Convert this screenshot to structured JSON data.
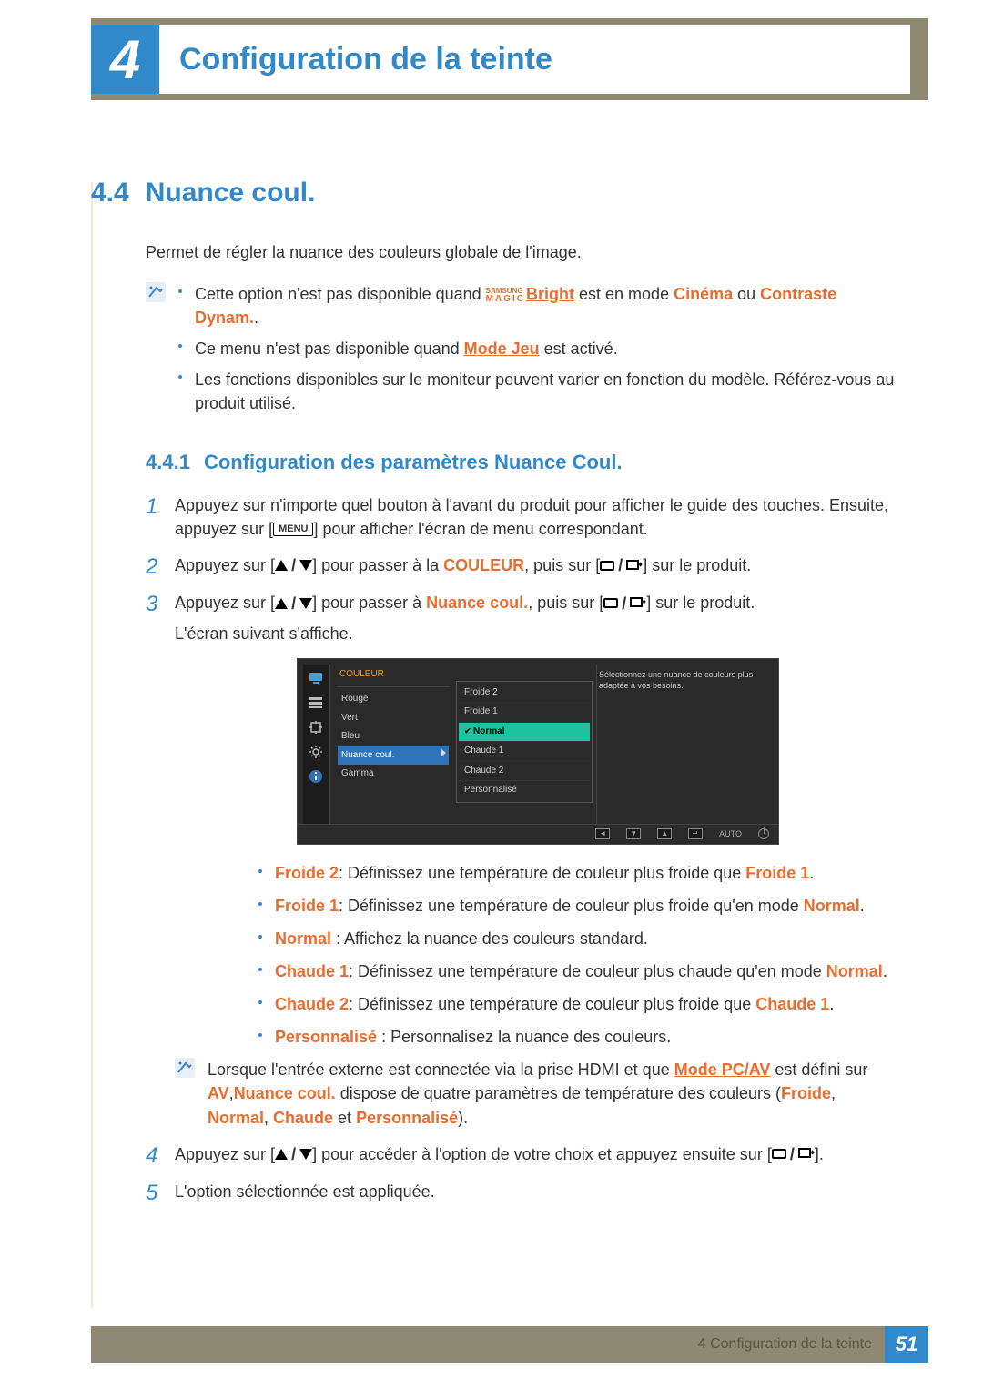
{
  "chapter": {
    "number": "4",
    "title": "Configuration de la teinte"
  },
  "section": {
    "number": "4.4",
    "title": "Nuance coul."
  },
  "intro": "Permet de régler la nuance des couleurs globale de l'image.",
  "notes1": {
    "items": [
      {
        "pre": "Cette option n'est pas disponible quand ",
        "magic_brand": "SAMSUNG",
        "magic_word": "MAGIC",
        "magic_suffix": "Bright",
        "mid": " est en mode ",
        "red1": "Cinéma",
        "mid2": " ou ",
        "red2": "Contraste Dynam.",
        "post": "."
      },
      {
        "text_pre": "Ce menu n'est pas disponible quand ",
        "link": "Mode Jeu",
        "text_post": " est activé."
      },
      {
        "plain": "Les fonctions disponibles sur le moniteur peuvent varier en fonction du modèle. Référez-vous au produit utilisé."
      }
    ]
  },
  "subsection": {
    "number": "4.4.1",
    "title": "Configuration des paramètres Nuance Coul."
  },
  "steps": {
    "s1a": "Appuyez sur n'importe quel bouton à l'avant du produit pour afficher le guide des touches. Ensuite, appuyez sur [",
    "s1_menu": "MENU",
    "s1b": "] pour afficher l'écran de menu correspondant.",
    "s2a": "Appuyez sur [",
    "s2b": "] pour passer à la ",
    "s2_red": "COULEUR",
    "s2c": ", puis sur [",
    "s2d": "] sur le produit.",
    "s3a": "Appuyez sur [",
    "s3b": "] pour passer à ",
    "s3_red": "Nuance coul.",
    "s3c": ", puis sur [",
    "s3d": "] sur le produit.",
    "s3e": "L'écran suivant s'affiche.",
    "s4a": "Appuyez sur [",
    "s4b": "] pour accéder à l'option de votre choix et appuyez ensuite sur [",
    "s4c": "].",
    "s5": "L'option sélectionnée est appliquée."
  },
  "osd": {
    "title": "COULEUR",
    "menu": [
      "Rouge",
      "Vert",
      "Bleu",
      "Nuance coul.",
      "Gamma"
    ],
    "menu_selected_index": 3,
    "submenu": [
      "Froide 2",
      "Froide 1",
      "Normal",
      "Chaude 1",
      "Chaude 2",
      "Personnalisé"
    ],
    "submenu_selected_index": 2,
    "desc": "Sélectionnez une nuance de couleurs plus adaptée à vos besoins.",
    "btn_auto": "AUTO"
  },
  "options": [
    {
      "name": "Froide 2",
      "desc": ": Définissez une température de couleur plus froide que ",
      "ref": "Froide 1",
      "tail": "."
    },
    {
      "name": "Froide 1",
      "desc": ": Définissez une température de couleur plus froide qu'en mode ",
      "ref": "Normal",
      "tail": "."
    },
    {
      "name": "Normal",
      "desc": " : Affichez la nuance des couleurs standard.",
      "ref": "",
      "tail": ""
    },
    {
      "name": "Chaude 1",
      "desc": ": Définissez une température de couleur plus chaude qu'en mode ",
      "ref": "Normal",
      "tail": "."
    },
    {
      "name": "Chaude 2",
      "desc": ": Définissez une température de couleur plus froide que ",
      "ref": "Chaude 1",
      "tail": "."
    },
    {
      "name": "Personnalisé",
      "desc": " : Personnalisez la nuance des couleurs.",
      "ref": "",
      "tail": ""
    }
  ],
  "note2": {
    "pre": "Lorsque l'entrée externe est connectée via la prise HDMI et que ",
    "link": "Mode PC/AV",
    "mid1": " est défini sur ",
    "av": "AV",
    "mid2": ",",
    "nuance": "Nuance coul.",
    "mid3": " dispose de quatre paramètres de température des couleurs (",
    "r1": "Froide",
    "c": ", ",
    "r2": "Normal",
    "r3": "Chaude",
    "and": " et ",
    "r4": "Personnalisé",
    "end": ")."
  },
  "footer": {
    "label": "4 Configuration de la teinte",
    "page": "51"
  }
}
